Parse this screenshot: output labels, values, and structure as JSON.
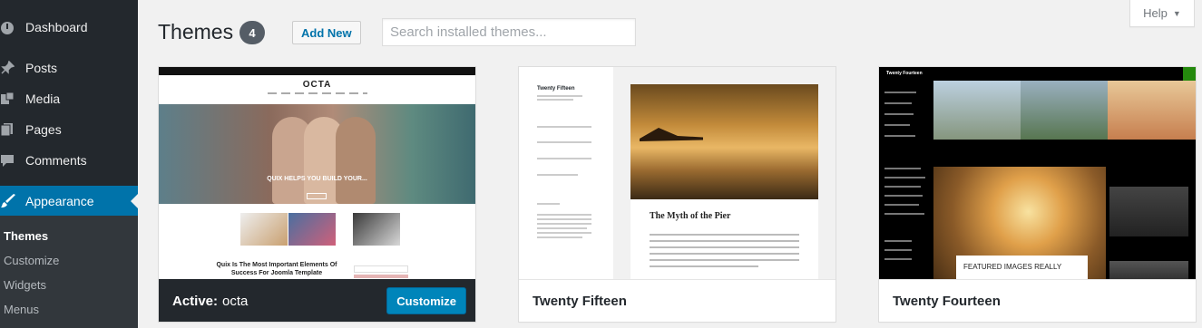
{
  "sidebar": {
    "items": [
      {
        "label": "Dashboard",
        "icon": "dashboard-icon"
      },
      {
        "label": "Posts",
        "icon": "pin-icon"
      },
      {
        "label": "Media",
        "icon": "media-icon"
      },
      {
        "label": "Pages",
        "icon": "pages-icon"
      },
      {
        "label": "Comments",
        "icon": "comments-icon"
      },
      {
        "label": "Appearance",
        "icon": "brush-icon"
      }
    ],
    "submenu": [
      "Themes",
      "Customize",
      "Widgets",
      "Menus"
    ]
  },
  "header": {
    "title": "Themes",
    "count": "4",
    "add_new": "Add New",
    "search_placeholder": "Search installed themes...",
    "help": "Help"
  },
  "themes": [
    {
      "active_prefix": "Active:",
      "name": "octa",
      "customize": "Customize",
      "preview": {
        "logo": "OCTA",
        "hero_title": "QUIX HELPS YOU BUILD YOUR...",
        "heading": "Quix Is The Most Important Elements Of Success For Joomla Template"
      }
    },
    {
      "name": "Twenty Fifteen",
      "preview": {
        "site_title": "Twenty Fifteen",
        "post_title": "The Myth of the Pier"
      }
    },
    {
      "name": "Twenty Fourteen",
      "preview": {
        "site_title": "Twenty Fourteen",
        "featured": "FEATURED IMAGES REALLY"
      }
    }
  ],
  "colors": {
    "sidebar_bg": "#23282d",
    "accent": "#0073aa",
    "button": "#0085ba"
  }
}
